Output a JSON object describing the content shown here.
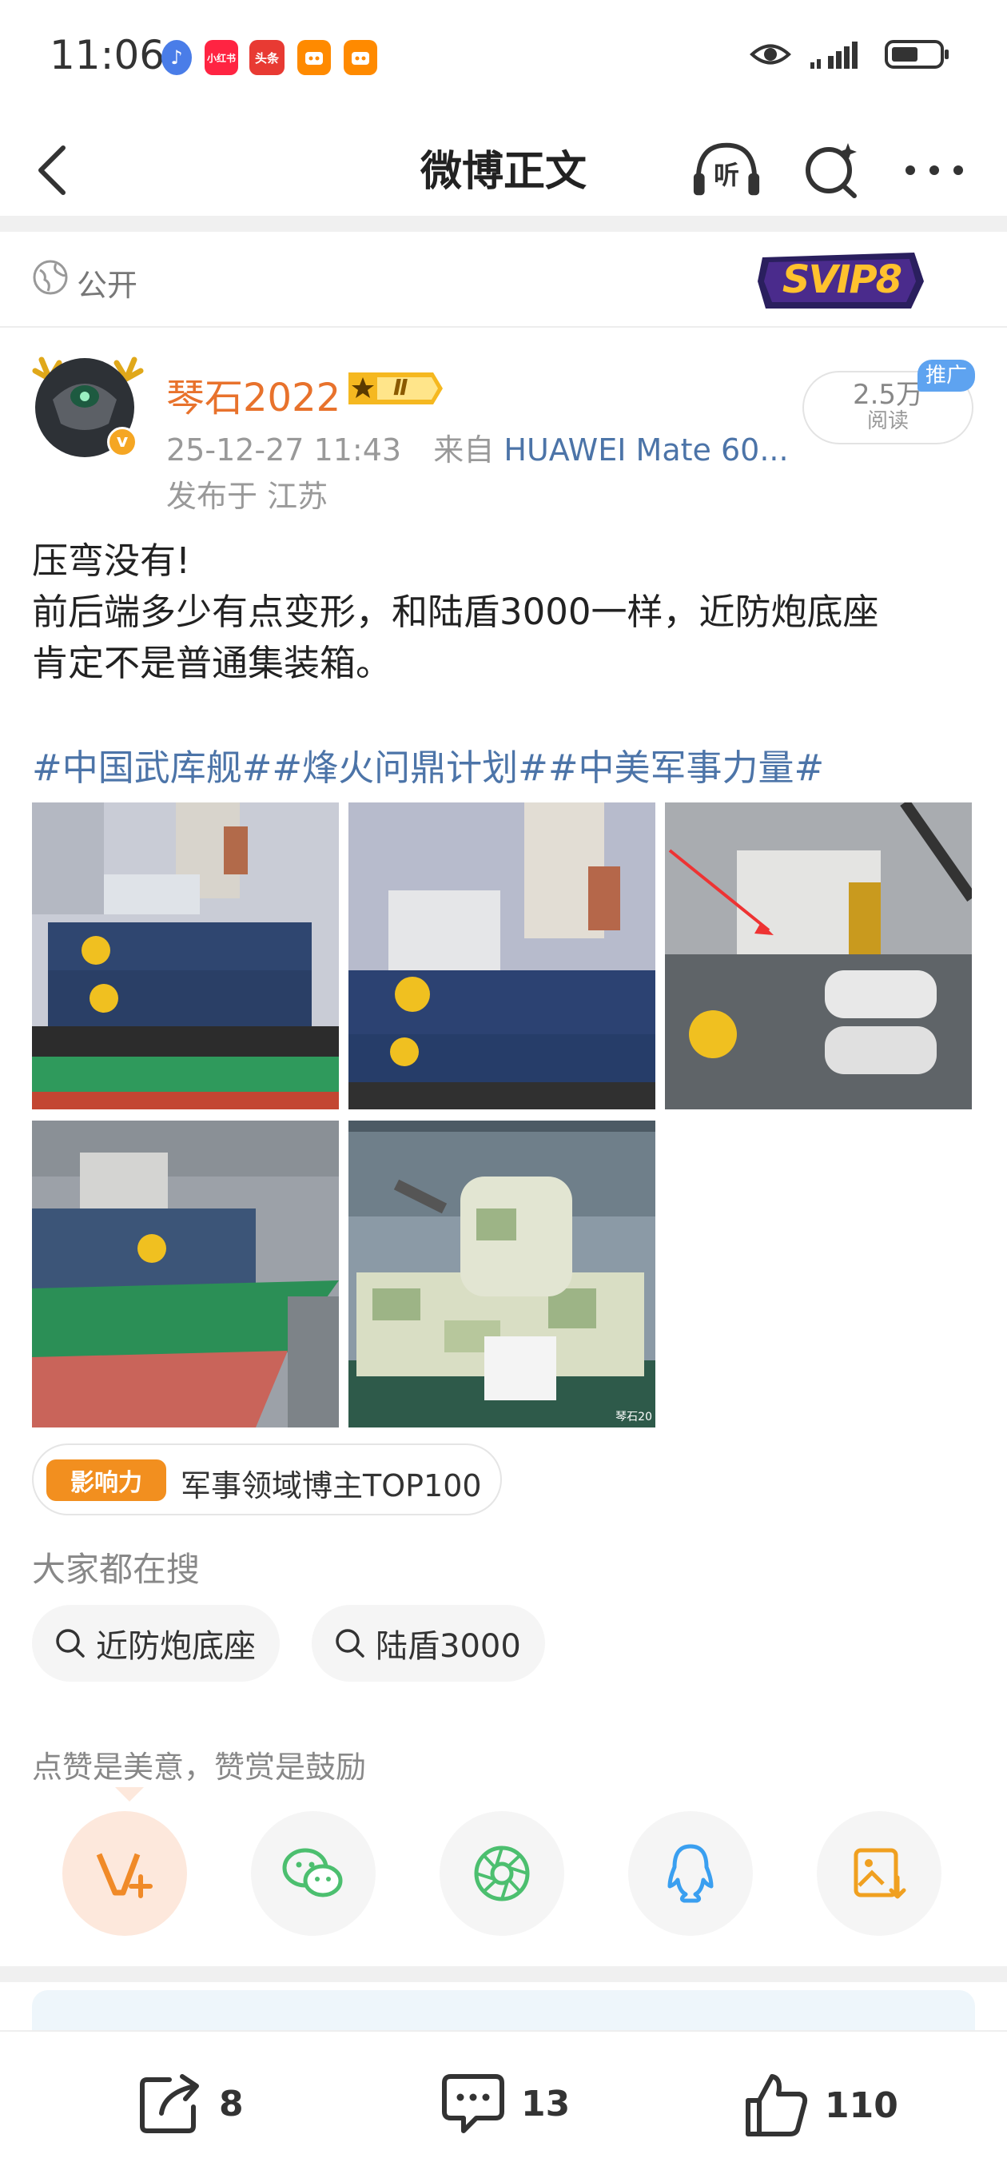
{
  "status_bar": {
    "time": "11:06",
    "apps": [
      {
        "label": "♪",
        "color": "#4a7de8"
      },
      {
        "label": "小红书",
        "color": "#ff2442"
      },
      {
        "label": "头条",
        "color": "#e83a33"
      },
      {
        "label": "",
        "color": "#ff8a00"
      },
      {
        "label": "",
        "color": "#ff8a00"
      }
    ],
    "signal_icon": "signal-icon",
    "battery_icon": "battery-icon"
  },
  "nav": {
    "title": "微博正文",
    "listen_label": "听"
  },
  "visibility": {
    "label": "公开",
    "vip_badge": "SVIP8"
  },
  "post": {
    "author": "琴石2022",
    "member_badge": "Ⅱ",
    "time": "25-12-27 11:43",
    "from_prefix": "来自",
    "source": "HUAWEI Mate 60...",
    "location": "发布于 江苏",
    "read_count": "2.5万",
    "read_label": "阅读",
    "promo_label": "推广",
    "text_lines": [
      "压弯没有!",
      "前后端多少有点变形，和陆盾3000一样，近防炮底座",
      "肯定不是普通集装箱。"
    ],
    "hashtags": "#中国武库舰##烽火问鼎计划##中美军事力量#",
    "photo_watermark": "琴石20",
    "influence": {
      "badge": "影响力",
      "text": "军事领域博主TOP100"
    }
  },
  "searches": {
    "title": "大家都在搜",
    "items": [
      "近防炮底座",
      "陆盾3000"
    ]
  },
  "reward": {
    "text": "点赞是美意，赞赏是鼓励"
  },
  "toolbar": {
    "repost_count": "8",
    "comment_count": "13",
    "like_count": "110"
  },
  "colors": {
    "accent_orange": "#e8722c",
    "link_blue": "#4c74a8",
    "wechat_green": "#4cbf6f",
    "qq_blue": "#3a9ff0"
  }
}
